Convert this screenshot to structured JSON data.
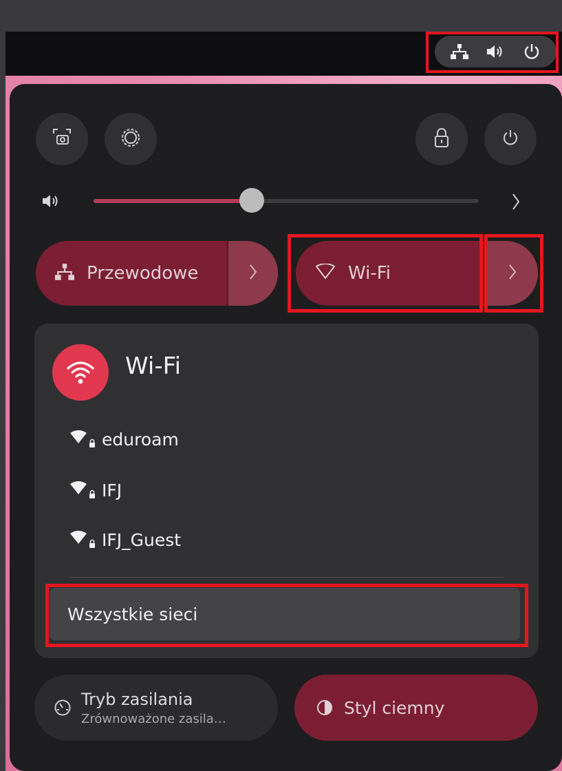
{
  "topbar": {
    "tray_icons": [
      "network-wired-icon",
      "volume-icon",
      "power-icon"
    ]
  },
  "quick_settings": {
    "top_buttons": [
      "screenshot-icon",
      "settings-icon",
      "lock-icon",
      "power-off-icon"
    ],
    "volume": {
      "level": 0.41,
      "icon": "volume-icon"
    },
    "wired": {
      "label": "Przewodowe",
      "icon": "network-wired-icon"
    },
    "wifi": {
      "label": "Wi-Fi",
      "icon": "wifi-outline-icon"
    },
    "wifi_menu": {
      "title": "Wi-Fi",
      "networks": [
        {
          "name": "eduroam",
          "secured": true
        },
        {
          "name": "IFJ",
          "secured": true
        },
        {
          "name": "IFJ_Guest",
          "secured": true
        }
      ],
      "all_networks_label": "Wszystkie sieci"
    },
    "power_mode": {
      "title": "Tryb zasilania",
      "subtitle": "Zrównoważone zasila…"
    },
    "dark_style": {
      "label": "Styl ciemny"
    }
  },
  "colors": {
    "accent": "#7c1e33",
    "accent_bright": "#e2384f",
    "highlight": "#e5161f",
    "panel": "#1d1d1f"
  }
}
